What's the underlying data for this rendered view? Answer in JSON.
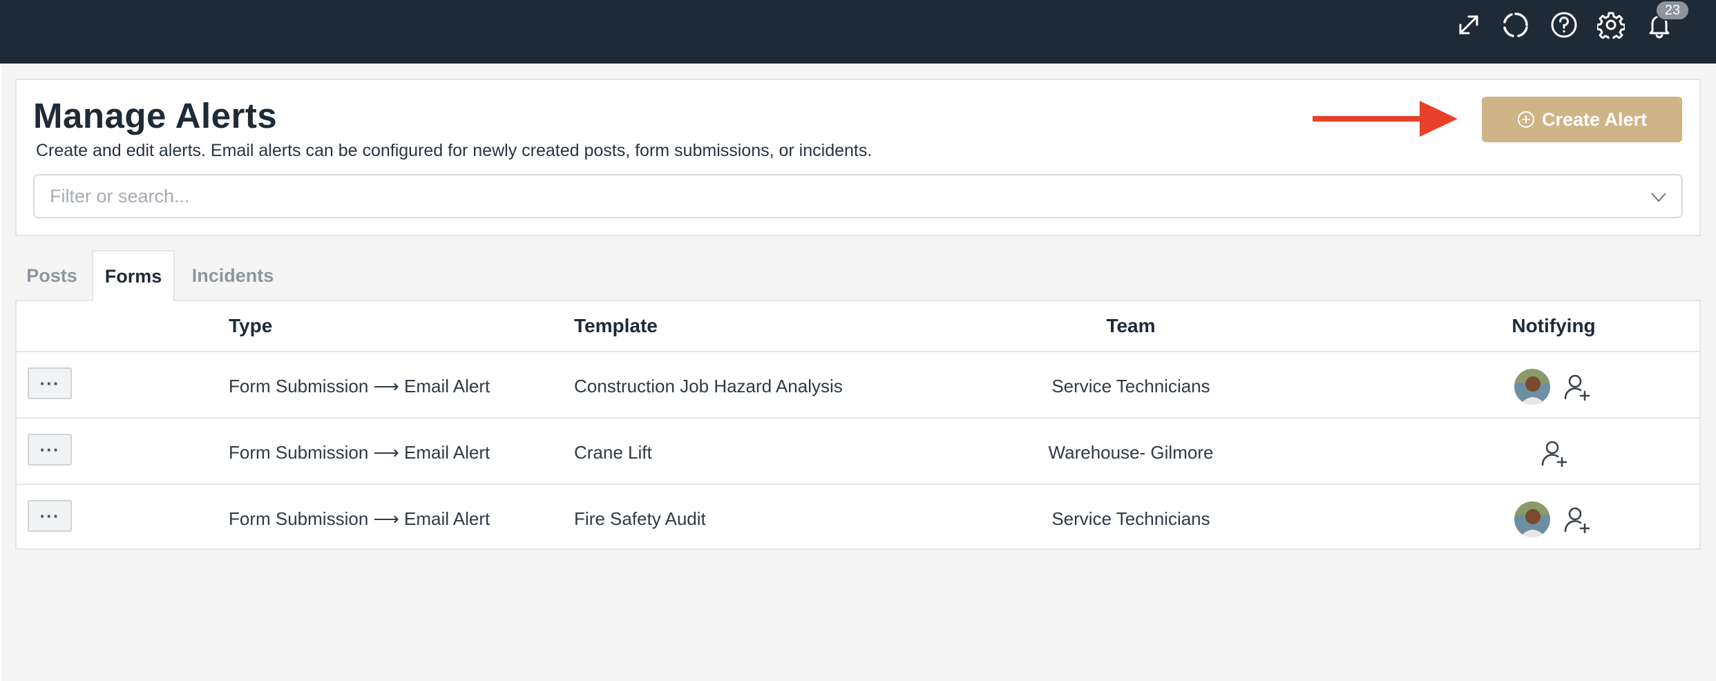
{
  "topbar": {
    "icons": [
      "expand-icon",
      "sync-icon",
      "help-icon",
      "gear-icon",
      "bell-icon"
    ],
    "notification_count": "23"
  },
  "header": {
    "title": "Manage Alerts",
    "subtitle": "Create and edit alerts. Email alerts can be configured for newly created posts, form submissions, or incidents.",
    "create_button_label": "Create Alert"
  },
  "search": {
    "placeholder": "Filter or search..."
  },
  "tabs": [
    {
      "label": "Posts",
      "active": false
    },
    {
      "label": "Forms",
      "active": true
    },
    {
      "label": "Incidents",
      "active": false
    }
  ],
  "table": {
    "columns": [
      "Type",
      "Template",
      "Team",
      "Notifying"
    ],
    "rows": [
      {
        "menu": "···",
        "type": "Form Submission ⟶ Email Alert",
        "template": "Construction Job Hazard Analysis",
        "team": "Service Technicians",
        "has_avatar": true
      },
      {
        "menu": "···",
        "type": "Form Submission ⟶ Email Alert",
        "template": "Crane Lift",
        "team": "Warehouse- Gilmore",
        "has_avatar": false
      },
      {
        "menu": "···",
        "type": "Form Submission ⟶ Email Alert",
        "template": "Fire Safety Audit",
        "team": "Service Technicians",
        "has_avatar": true
      }
    ]
  },
  "colors": {
    "topbar": "#1e2a36",
    "create_button": "#cfb487",
    "annotation_arrow": "#e8402a",
    "page_bg": "#f5f5f5"
  }
}
